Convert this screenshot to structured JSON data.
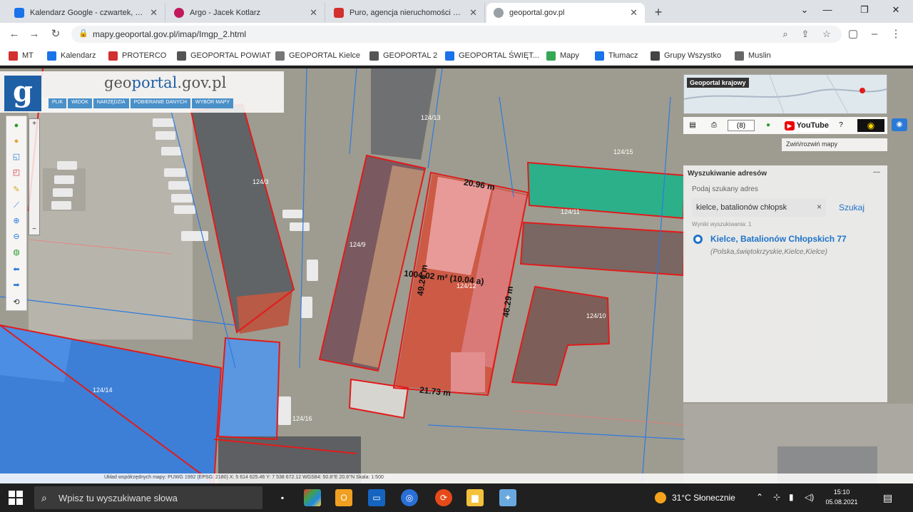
{
  "browser": {
    "tabs": [
      {
        "title": "Kalendarz Google - czwartek, 4 ...",
        "fav_color": "#1a73e8"
      },
      {
        "title": "Argo - Jacek Kotlarz",
        "fav_color": "#c2185b"
      },
      {
        "title": "Puro, agencja nieruchomości Kie...",
        "fav_color": "#d32f2f"
      },
      {
        "title": "geoportal.gov.pl",
        "fav_color": "#9aa0a6"
      }
    ],
    "new_tab": "+",
    "url": "mapy.geoportal.gov.pl/imap/Imgp_2.html",
    "bookmarks": [
      {
        "label": "MT",
        "color": "#d32f2f"
      },
      {
        "label": "Kalendarz",
        "color": "#1a73e8"
      },
      {
        "label": "PROTERCO",
        "color": "#d32f2f"
      },
      {
        "label": "GEOPORTAL POWIAT",
        "color": "#555555"
      },
      {
        "label": "GEOPORTAL Kielce",
        "color": "#777777"
      },
      {
        "label": "GEOPORTAL 2",
        "color": "#555555"
      },
      {
        "label": "GEOPORTAL ŚWIĘT...",
        "color": "#1a73e8"
      },
      {
        "label": "Mapy",
        "color": "#34a853"
      },
      {
        "label": "Tłumacz",
        "color": "#1a73e8"
      },
      {
        "label": "Grupy Wszystko",
        "color": "#444444"
      },
      {
        "label": "Muslin",
        "color": "#666666"
      }
    ]
  },
  "geoportal": {
    "logo_letter": "g",
    "title_plain": "geo",
    "title_accent": "portal",
    "title_suffix": ".gov.pl",
    "menu": [
      "PLIK",
      "WIDOK",
      "NARZĘDZIA",
      "POBIERANIE DANYCH",
      "WYBÓR MAPY"
    ],
    "minimap_label": "Geoportal krajowy",
    "scale_select": "(8)",
    "youtube_label": "YouTube",
    "collapse_label": "Zwiń/rozwiń mapy",
    "search_panel": {
      "title": "Wyszukiwanie adresów",
      "input_label": "Podaj szukany adres",
      "input_value": "kielce, batalionów chłopsk",
      "clear": "×",
      "search_button": "Szukaj",
      "found": "Wyniki wyszukiwania: 1",
      "result": "Kielce, Batalionów Chłopskich 77",
      "result_sub": "(Polska,świętokrzyskie,Kielce,Kielce)"
    },
    "map_labels": {
      "dim_top": "20.96 m",
      "dim_bottom": "21.73 m",
      "dim_left": "49.26 m",
      "dim_right": "46.29 m",
      "area": "1004.02 m² (10.04 a)",
      "parcels": [
        "124/9",
        "124/14",
        "124/3",
        "124/12",
        "124/10",
        "124/11",
        "124/13",
        "124/15",
        "124/16"
      ]
    },
    "status_bar": "Układ współrzędnych mapy: PUWG 1992 (EPSG: 2180)     X: 5 614 625.46 Y: 7 538 672.12     WGS84: 50.8°E 20.6°N     Skala: 1:500"
  },
  "taskbar": {
    "search_placeholder": "Wpisz tu wyszukiwane słowa",
    "weather": "31°C  Słonecznie",
    "time": "15:10",
    "date": "05.08.2021"
  }
}
